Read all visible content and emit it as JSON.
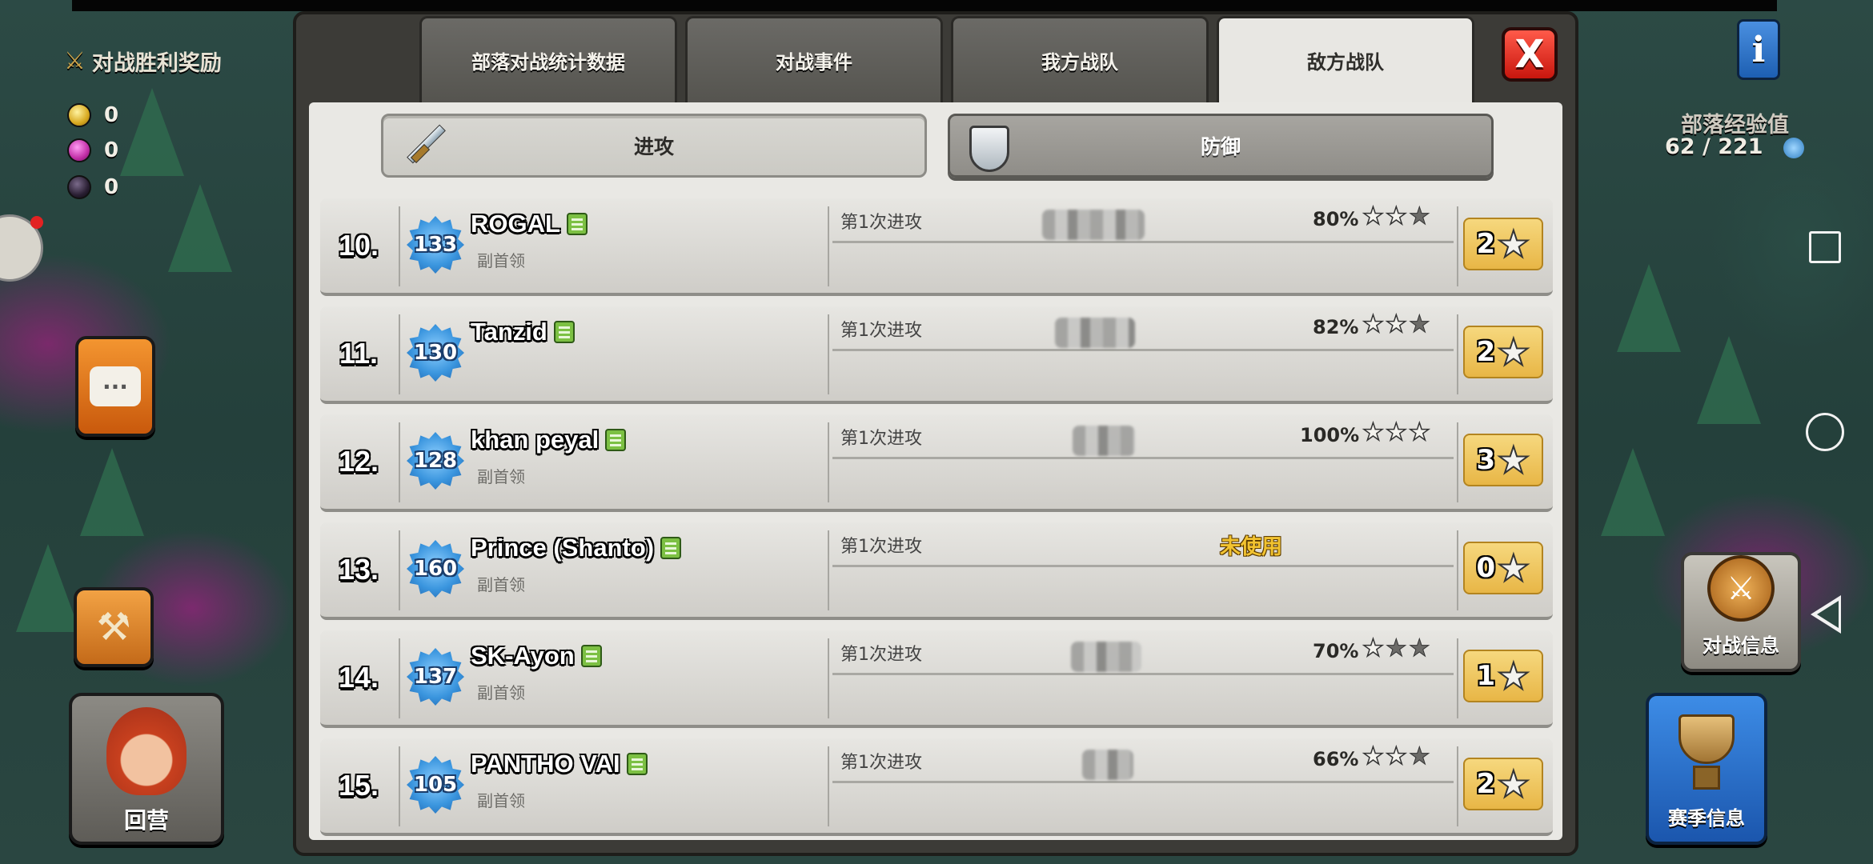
{
  "hud_left": {
    "war_reward_label": "对战胜利奖励",
    "resources": [
      {
        "icon": "gold-icon",
        "value": "0"
      },
      {
        "icon": "elixir-icon",
        "value": "0"
      },
      {
        "icon": "dark-elixir-icon",
        "value": "0"
      }
    ],
    "hero_button_label": "回营"
  },
  "hud_right": {
    "clan_xp_label": "部落经验值",
    "clan_xp_value": "62 / 221",
    "war_info_label": "对战信息",
    "season_info_label": "赛季信息"
  },
  "tabs": [
    {
      "label": "部落对战统计数据",
      "active": false
    },
    {
      "label": "对战事件",
      "active": false
    },
    {
      "label": "我方战队",
      "active": false
    },
    {
      "label": "敌方战队",
      "active": true
    }
  ],
  "close_label": "X",
  "subtabs": {
    "attack_label": "进攻",
    "defense_label": "防御"
  },
  "rows": [
    {
      "rank": "10.",
      "level": "133",
      "name": "ROGAL",
      "role": "副首领",
      "attack_label": "第1次进攻",
      "percent": "80%",
      "stars_earned": 2,
      "stars_total": "2",
      "unused": ""
    },
    {
      "rank": "11.",
      "level": "130",
      "name": "Tanzid",
      "role": "",
      "attack_label": "第1次进攻",
      "percent": "82%",
      "stars_earned": 2,
      "stars_total": "2",
      "unused": ""
    },
    {
      "rank": "12.",
      "level": "128",
      "name": "khan peyal",
      "role": "副首领",
      "attack_label": "第1次进攻",
      "percent": "100%",
      "stars_earned": 3,
      "stars_total": "3",
      "unused": ""
    },
    {
      "rank": "13.",
      "level": "160",
      "name": "Prince (Shanto)",
      "role": "副首领",
      "attack_label": "第1次进攻",
      "percent": "",
      "stars_earned": 0,
      "stars_total": "0",
      "unused": "未使用"
    },
    {
      "rank": "14.",
      "level": "137",
      "name": "SK-Ayon",
      "role": "副首领",
      "attack_label": "第1次进攻",
      "percent": "70%",
      "stars_earned": 1,
      "stars_total": "1",
      "unused": ""
    },
    {
      "rank": "15.",
      "level": "105",
      "name": "PANTHO VAI",
      "role": "副首领",
      "attack_label": "第1次进攻",
      "percent": "66%",
      "stars_earned": 2,
      "stars_total": "2",
      "unused": ""
    }
  ],
  "colors": {
    "active_tab": "#e8e7e3",
    "close_red": "#e02a1e",
    "star_box": "#f0c85e",
    "unused_text": "#f2c330"
  }
}
